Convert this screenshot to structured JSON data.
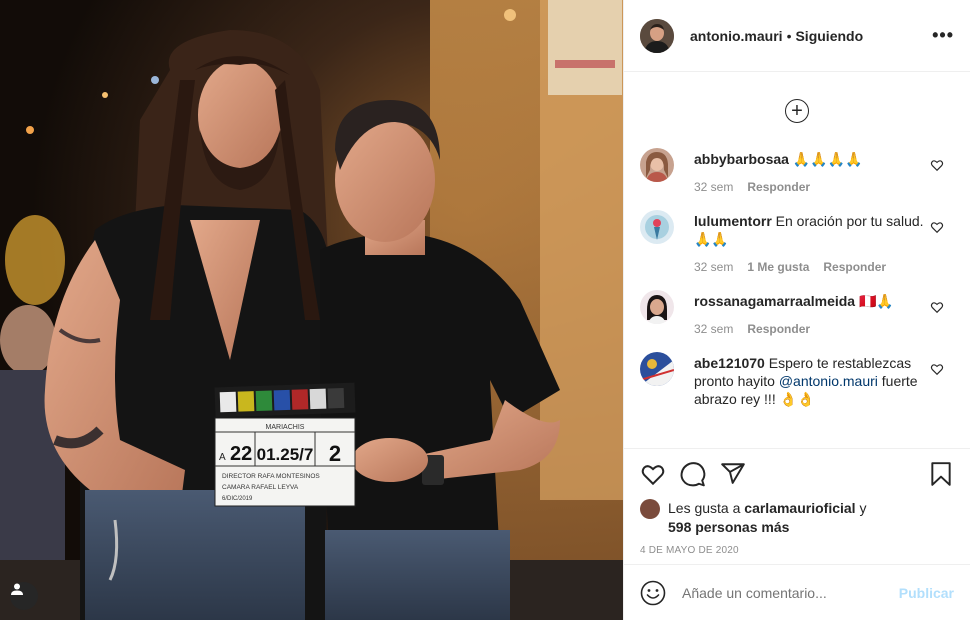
{
  "post": {
    "author": "antonio.mauri",
    "separator": "•",
    "follow_status": "Siguiendo",
    "more_icon": "more-options-icon",
    "clapperboard": {
      "production": "MARIACHIS",
      "scene_label": "A",
      "scene": "22",
      "shot": "01.25/7",
      "take": "2",
      "director": "DIRECTOR RAFA MONTESINOS",
      "camera": "CAMARA RAFAEL LEYVA",
      "date": "6/DIC/2019"
    }
  },
  "comments": [
    {
      "user": "abbybarbosaa",
      "text": "🙏🙏🙏🙏",
      "time": "32 sem",
      "likes": "",
      "reply": "Responder"
    },
    {
      "user": "lulumentorr",
      "text": "En oración por tu salud. 🙏🙏",
      "time": "32 sem",
      "likes": "1 Me gusta",
      "reply": "Responder"
    },
    {
      "user": "rossanagamarraalmeida",
      "text": "🇵🇪🙏",
      "time": "32 sem",
      "likes": "",
      "reply": "Responder"
    },
    {
      "user": "abe121070",
      "text": "Espero te restablezcas pronto hayito",
      "mention": "@antonio.mauri",
      "text_after": "fuerte abrazo rey !!! 👌👌",
      "time": "",
      "likes": "",
      "reply": ""
    }
  ],
  "likes": {
    "prefix": "Les gusta a",
    "user": "carlamaurioficial",
    "conj": "y",
    "others": "598 personas más"
  },
  "date": "4 DE MAYO DE 2020",
  "add_comment": {
    "placeholder": "Añade un comentario...",
    "publish": "Publicar"
  },
  "colors": {
    "primary_text": "#262626",
    "secondary_text": "#8e8e8e",
    "link": "#00376b",
    "publish_disabled": "#b2dffc",
    "border": "#efefef"
  }
}
